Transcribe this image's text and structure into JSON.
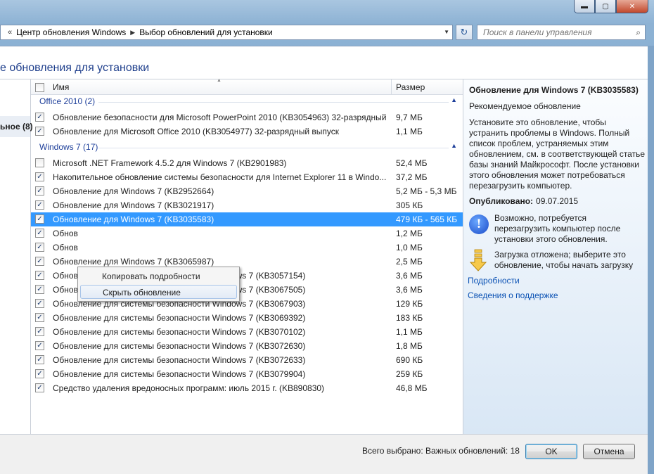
{
  "window": {
    "min_glyph": "▬",
    "max_glyph": "▢",
    "close_glyph": "✕"
  },
  "address": {
    "chevron": "«",
    "crumbs": [
      "Центр обновления Windows",
      "Выбор обновлений для установки"
    ],
    "separator": "▶",
    "dropdown": "▼"
  },
  "refresh_glyph": "↻",
  "search": {
    "placeholder": "Поиск в панели управления",
    "icon": "search-icon",
    "glyph": "⌕"
  },
  "page": {
    "heading": "е обновления для установки"
  },
  "left_nav": {
    "item": "ьное (8)"
  },
  "columns": {
    "name": "Имя",
    "size": "Размер",
    "sort_glyph": "▲"
  },
  "groups": [
    {
      "label": "Office 2010 (2)",
      "arrow": "▲"
    },
    {
      "label": "Windows 7 (17)",
      "arrow": "▲"
    }
  ],
  "rows": [
    {
      "checked": true,
      "name": "Обновление безопасности для Microsoft PowerPoint 2010 (KB3054963) 32-разрядный ...",
      "size": "9,7 МБ"
    },
    {
      "checked": true,
      "name": "Обновление для Microsoft Office 2010 (KB3054977) 32-разрядный выпуск",
      "size": "1,1 МБ"
    },
    {
      "checked": false,
      "name": "Microsoft .NET Framework 4.5.2 для Windows 7 (KB2901983)",
      "size": "52,4 МБ"
    },
    {
      "checked": true,
      "name": "Накопительное обновление системы безопасности для Internet Explorer 11 в Windo...",
      "size": "37,2 МБ"
    },
    {
      "checked": true,
      "name": "Обновление для Windows 7 (KB2952664)",
      "size": "5,2 МБ - 5,3 МБ"
    },
    {
      "checked": true,
      "name": "Обновление для Windows 7 (KB3021917)",
      "size": "305 КБ"
    },
    {
      "checked": true,
      "name": "Обновление для Windows 7 (KB3035583)",
      "size": "479 КБ - 565 КБ",
      "selected": true
    },
    {
      "checked": true,
      "name": "Обнов",
      "size": "1,2 МБ"
    },
    {
      "checked": true,
      "name": "Обнов",
      "size": "1,0 МБ"
    },
    {
      "checked": true,
      "name": "Обновление для Windows 7 (KB3065987)",
      "size": "2,5 МБ"
    },
    {
      "checked": true,
      "name": "Обновление для системы безопасности Windows 7 (KB3057154)",
      "size": "3,6 МБ"
    },
    {
      "checked": true,
      "name": "Обновление для системы безопасности Windows 7 (KB3067505)",
      "size": "3,6 МБ"
    },
    {
      "checked": true,
      "name": "Обновление для системы безопасности Windows 7 (KB3067903)",
      "size": "129 КБ"
    },
    {
      "checked": true,
      "name": "Обновление для системы безопасности Windows 7 (KB3069392)",
      "size": "183 КБ"
    },
    {
      "checked": true,
      "name": "Обновление для системы безопасности Windows 7 (KB3070102)",
      "size": "1,1 МБ"
    },
    {
      "checked": true,
      "name": "Обновление для системы безопасности Windows 7 (KB3072630)",
      "size": "1,8 МБ"
    },
    {
      "checked": true,
      "name": "Обновление для системы безопасности Windows 7 (KB3072633)",
      "size": "690 КБ"
    },
    {
      "checked": true,
      "name": "Обновление для системы безопасности Windows 7 (KB3079904)",
      "size": "259 КБ"
    },
    {
      "checked": true,
      "name": "Средство удаления вредоносных программ: июль 2015 г. (KB890830)",
      "size": "46,8 МБ"
    }
  ],
  "check_glyph": "✓",
  "context_menu": {
    "items": [
      "Копировать подробности",
      "Скрыть обновление"
    ]
  },
  "details": {
    "title": "Обновление для Windows 7 (KB3035583)",
    "subtitle": "Рекомендуемое обновление",
    "description": "Установите это обновление, чтобы устранить проблемы в Windows. Полный список проблем, устраняемых этим обновлением, см. в соответствующей статье базы знаний Майкрософт. После установки этого обновления может потребоваться перезагрузить компьютер.",
    "published_label": "Опубликовано:",
    "published_date": "09.07.2015",
    "info_glyph": "!",
    "restart_note": "Возможно, потребуется перезагрузить компьютер после установки этого обновления.",
    "download_note": "Загрузка отложена; выберите это обновление, чтобы начать загрузку",
    "link_details": "Подробности",
    "link_support": "Сведения о поддержке"
  },
  "footer": {
    "status": "Всего выбрано: Важных обновлений: 18",
    "ok": "OK",
    "cancel": "Отмена"
  },
  "colors": {
    "selection": "#3399ff",
    "heading": "#1f3f8c",
    "link": "#0b52b4",
    "group": "#1e3f9a"
  }
}
